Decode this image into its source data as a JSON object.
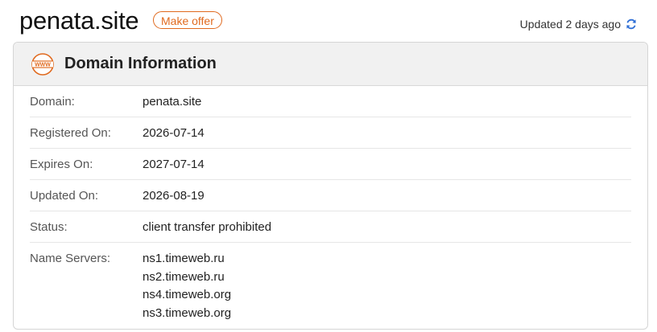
{
  "header": {
    "site_title": "penata.site",
    "offer_label": "Make offer",
    "updated_text": "Updated 2 days ago"
  },
  "card": {
    "title": "Domain Information",
    "rows": [
      {
        "label": "Domain:",
        "value": "penata.site"
      },
      {
        "label": "Registered On:",
        "value": "2026-07-14"
      },
      {
        "label": "Expires On:",
        "value": "2027-07-14"
      },
      {
        "label": "Updated On:",
        "value": "2026-08-19"
      },
      {
        "label": "Status:",
        "value": "client transfer prohibited"
      }
    ],
    "name_servers": {
      "label": "Name Servers:",
      "items": [
        "ns1.timeweb.ru",
        "ns2.timeweb.ru",
        "ns4.timeweb.org",
        "ns3.timeweb.org"
      ]
    }
  },
  "icons": {
    "www": "www-icon",
    "refresh": "refresh-icon"
  },
  "colors": {
    "accent_orange": "#e06a1f",
    "refresh_blue": "#2f6fd6",
    "card_header_bg": "#f1f1f1"
  }
}
